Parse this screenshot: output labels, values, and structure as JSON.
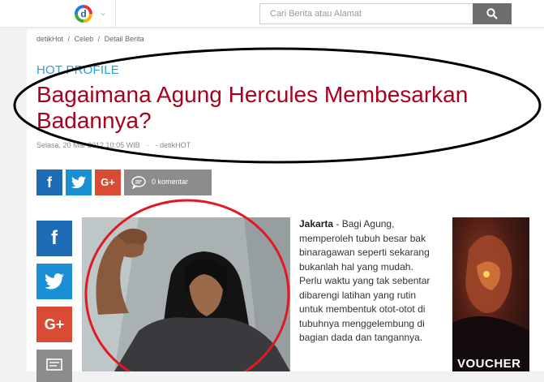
{
  "header": {
    "logo_letter": "d",
    "search_placeholder": "Cari Berita atau Alamat"
  },
  "breadcrumb": [
    "detikHot",
    "/",
    "Celeb",
    "/",
    "Detail Berita"
  ],
  "article": {
    "kicker": "HOT PROFILE",
    "title": "Bagaimana Agung Hercules Membesarkan Badannya?",
    "date": "Selasa, 20 Mar 2012 10:05 WIB",
    "author": "- detikHOT",
    "dateline": "Jakarta",
    "body": " - Bagi Agung, memperoleh tubuh besar bak binaragawan seperti sekarang bukanlah hal yang mudah. Perlu waktu yang tak sebentar dibarengi latihan yang rutin untuk membentuk otot-otot di tubuhnya menggelembung di bagian dada dan tangannya."
  },
  "share": {
    "facebook": "f",
    "twitter": "t",
    "googleplus": "G+",
    "comment_label": "0 komentar"
  },
  "ad": {
    "label": "VOUCHER"
  },
  "colors": {
    "headline": "#a9001e",
    "kicker": "#2aa0d5",
    "facebook": "#1e6cb6",
    "twitter": "#1b8fd4",
    "googleplus": "#d94b35"
  }
}
